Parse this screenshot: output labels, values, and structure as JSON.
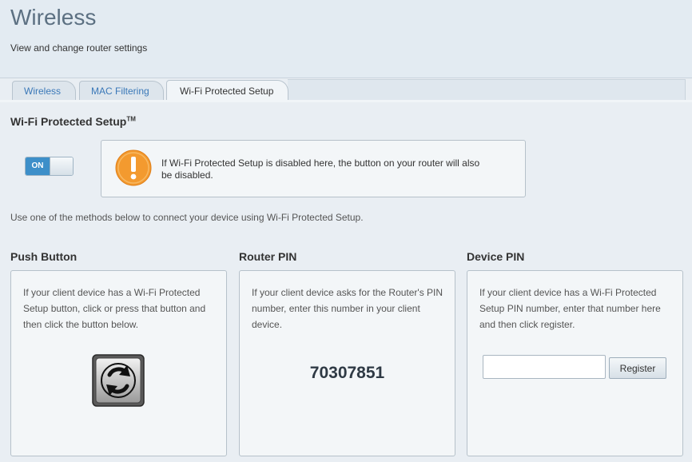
{
  "header": {
    "title": "Wireless",
    "subtitle": "View and change router settings"
  },
  "tabs": [
    {
      "label": "Wireless",
      "active": false
    },
    {
      "label": "MAC Filtering",
      "active": false
    },
    {
      "label": "Wi-Fi Protected Setup",
      "active": true
    }
  ],
  "wps": {
    "title": "Wi-Fi Protected Setup",
    "trademark": "TM",
    "toggle": {
      "label": "ON",
      "state": "on"
    },
    "warning": "If Wi-Fi Protected Setup is disabled here, the button on your router will also be disabled.",
    "instructions": "Use one of the methods below to connect your device using Wi-Fi Protected Setup."
  },
  "methods": {
    "push_button": {
      "title": "Push Button",
      "description": "If your client device has a Wi-Fi Protected Setup button, click or press that button and then click the button below."
    },
    "router_pin": {
      "title": "Router PIN",
      "description": "If your client device asks for the Router's PIN number, enter this number in your client device.",
      "pin": "70307851"
    },
    "device_pin": {
      "title": "Device PIN",
      "description": "If your client device has a Wi-Fi Protected Setup PIN number, enter that number here and then click register.",
      "input_value": "",
      "register_label": "Register"
    }
  },
  "colors": {
    "accent": "#3d8fc9",
    "warning": "#f39a2f",
    "tab_link": "#3a78b8"
  }
}
